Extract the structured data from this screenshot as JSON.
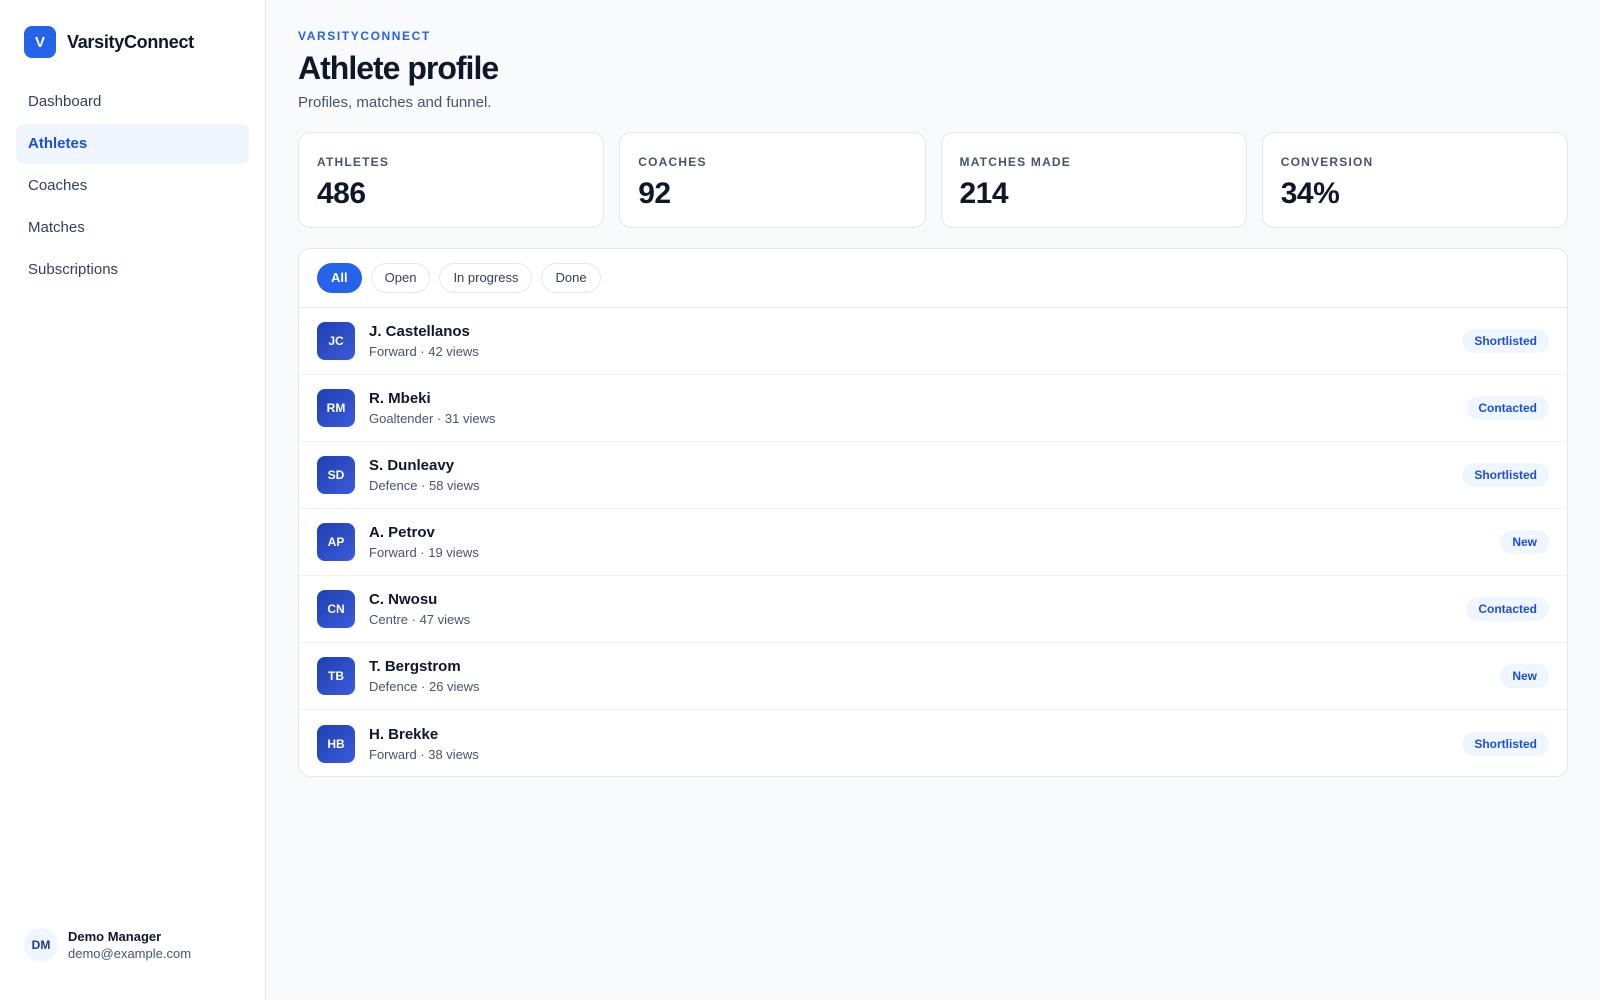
{
  "brand": {
    "logo_letter": "V",
    "name": "VarsityConnect"
  },
  "nav": {
    "items": [
      {
        "label": "Dashboard",
        "active": false
      },
      {
        "label": "Athletes",
        "active": true
      },
      {
        "label": "Coaches",
        "active": false
      },
      {
        "label": "Matches",
        "active": false
      },
      {
        "label": "Subscriptions",
        "active": false
      }
    ]
  },
  "user": {
    "initials": "DM",
    "name": "Demo Manager",
    "email": "demo@example.com"
  },
  "header": {
    "eyebrow": "VARSITYCONNECT",
    "title": "Athlete profile",
    "subtitle": "Profiles, matches and funnel."
  },
  "stats": [
    {
      "label": "ATHLETES",
      "value": "486"
    },
    {
      "label": "COACHES",
      "value": "92"
    },
    {
      "label": "MATCHES MADE",
      "value": "214"
    },
    {
      "label": "CONVERSION",
      "value": "34%"
    }
  ],
  "filters": [
    {
      "label": "All",
      "active": true
    },
    {
      "label": "Open",
      "active": false
    },
    {
      "label": "In progress",
      "active": false
    },
    {
      "label": "Done",
      "active": false
    }
  ],
  "athletes": [
    {
      "initials": "JC",
      "name": "J. Castellanos",
      "meta": "Forward · 42 views",
      "status": "Shortlisted"
    },
    {
      "initials": "RM",
      "name": "R. Mbeki",
      "meta": "Goaltender · 31 views",
      "status": "Contacted"
    },
    {
      "initials": "SD",
      "name": "S. Dunleavy",
      "meta": "Defence · 58 views",
      "status": "Shortlisted"
    },
    {
      "initials": "AP",
      "name": "A. Petrov",
      "meta": "Forward · 19 views",
      "status": "New"
    },
    {
      "initials": "CN",
      "name": "C. Nwosu",
      "meta": "Centre · 47 views",
      "status": "Contacted"
    },
    {
      "initials": "TB",
      "name": "T. Bergstrom",
      "meta": "Defence · 26 views",
      "status": "New"
    },
    {
      "initials": "HB",
      "name": "H. Brekke",
      "meta": "Forward · 38 views",
      "status": "Shortlisted"
    }
  ],
  "colors": {
    "accent": "#2563eb",
    "active_bg": "#eff6ff",
    "text": "#0f172a",
    "muted": "#475569"
  }
}
